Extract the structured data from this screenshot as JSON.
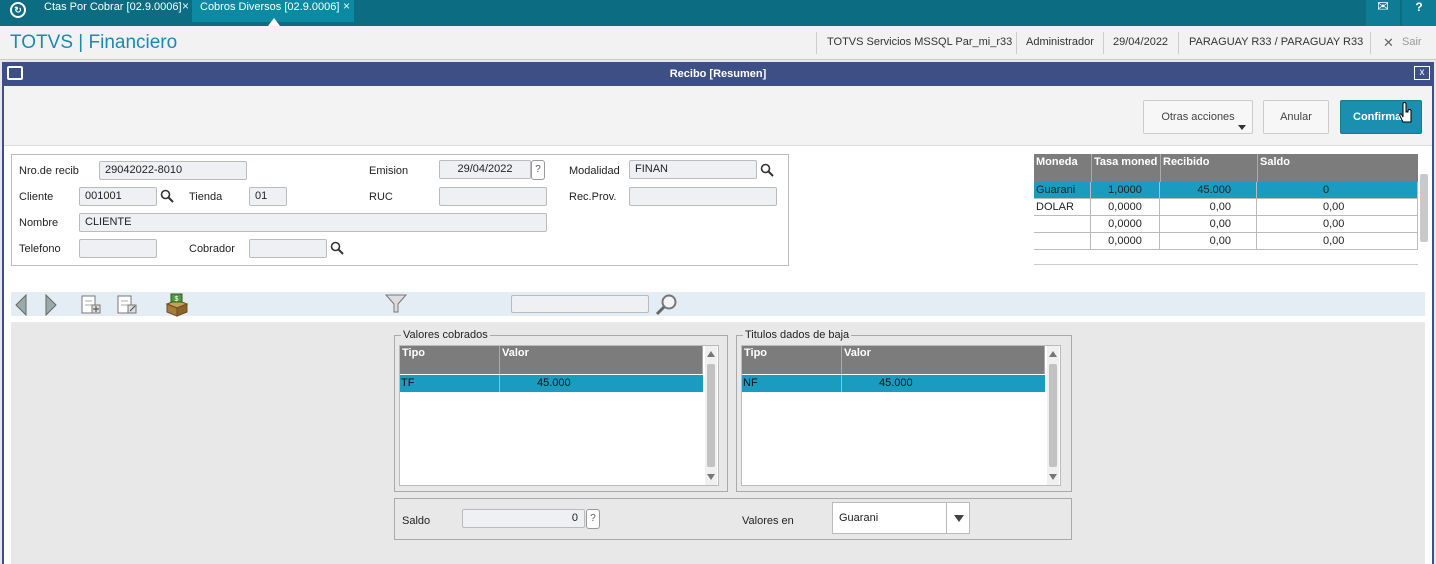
{
  "topbar": {
    "tabs": [
      {
        "label": "Ctas Por Cobrar [02.9.0006]",
        "close": "×"
      },
      {
        "label": "Cobros Diversos [02.9.0006]",
        "close": "×"
      }
    ],
    "mail_icon": "mail-icon",
    "help_icon": "help-icon",
    "help_glyph": "?"
  },
  "header": {
    "title": "TOTVS | Financiero",
    "environment": "TOTVS Servicios MSSQL Par_mi_r33",
    "user": "Administrador",
    "date": "29/04/2022",
    "company": "PARAGUAY R33 / PARAGUAY R33",
    "exit_label": "Sair",
    "exit_glyph": "✕"
  },
  "dialog": {
    "title": "Recibo [Resumen]",
    "close_glyph": "x"
  },
  "actions": {
    "otras": "Otras acciones",
    "anular": "Anular",
    "confirmar": "Confirmar"
  },
  "form": {
    "nro_label": "Nro.de recib",
    "nro_value": "29042022-8010",
    "emision_label": "Emision",
    "emision_value": "29/04/2022",
    "modalidad_label": "Modalidad",
    "modalidad_value": "FINAN",
    "cliente_label": "Cliente",
    "cliente_value": "001001",
    "tienda_label": "Tienda",
    "tienda_value": "01",
    "ruc_label": "RUC",
    "ruc_value": "",
    "recprov_label": "Rec.Prov.",
    "recprov_value": "",
    "nombre_label": "Nombre",
    "nombre_value": "CLIENTE",
    "telefono_label": "Telefono",
    "telefono_value": "",
    "cobrador_label": "Cobrador",
    "cobrador_value": "",
    "help_glyph": "?"
  },
  "currency_table": {
    "headers": [
      "Moneda",
      "Tasa moned",
      "Recibido",
      "Saldo"
    ],
    "rows": [
      [
        "Guarani",
        "1,0000",
        "45.000",
        "0"
      ],
      [
        "DOLAR",
        "0,0000",
        "0,00",
        "0,00"
      ],
      [
        "",
        "0,0000",
        "0,00",
        "0,00"
      ],
      [
        "",
        "0,0000",
        "0,00",
        "0,00"
      ]
    ]
  },
  "valores_cobrados": {
    "title": "Valores cobrados",
    "headers": [
      "Tipo",
      "Valor"
    ],
    "rows": [
      [
        "TF",
        "45.000"
      ]
    ]
  },
  "titulos_baja": {
    "title": "Titulos dados de baja",
    "headers": [
      "Tipo",
      "Valor"
    ],
    "rows": [
      [
        "NF",
        "45.000"
      ]
    ]
  },
  "footer": {
    "saldo_label": "Saldo",
    "saldo_value": "0",
    "help_glyph": "?",
    "valores_en_label": "Valores en",
    "valores_en_value": "Guarani"
  },
  "colors": {
    "topbar": "#0b6c82",
    "accent": "#1a8fb0",
    "dialog_title": "#3e4f86",
    "selected_row": "#1a9cc0"
  }
}
